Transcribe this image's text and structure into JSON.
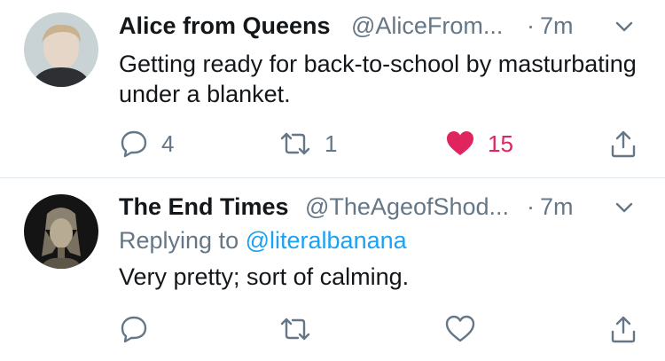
{
  "tweets": [
    {
      "display_name": "Alice from Queens",
      "handle": "@AliceFrom...",
      "dot": "·",
      "time": "7m",
      "text": "Getting ready for back-to-school by masturbating under a blanket.",
      "reply_count": "4",
      "retweet_count": "1",
      "like_count": "15",
      "liked": true
    },
    {
      "display_name": "The End Times",
      "handle": "@TheAgeofShod...",
      "dot": "·",
      "time": "7m",
      "replying_to_label": "Replying to",
      "replying_to_handle": "@literalbanana",
      "text": "Very pretty; sort of calming.",
      "liked": false
    }
  ],
  "icons": {
    "reply": "reply-icon",
    "retweet": "retweet-icon",
    "like": "heart-icon",
    "share": "share-icon",
    "more": "chevron-down-icon"
  },
  "colors": {
    "text": "#14171a",
    "secondary": "#657786",
    "like": "#e0245e",
    "link": "#1da1f2",
    "divider": "#e1e8ed"
  }
}
